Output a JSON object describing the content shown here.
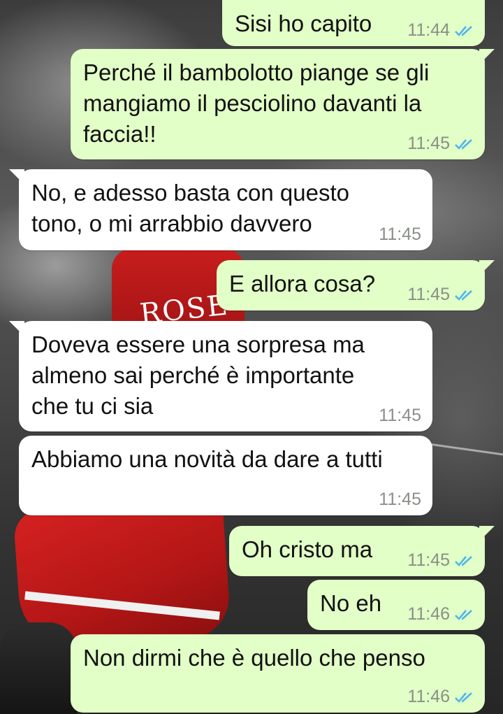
{
  "messages": [
    {
      "direction": "outgoing",
      "text": "Sisi ho capito",
      "time": "11:44",
      "status": "read"
    },
    {
      "direction": "outgoing",
      "text": "Perché il bambolotto piange se gli mangiamo il pesciolino davanti la faccia!!",
      "time": "11:45",
      "status": "read"
    },
    {
      "direction": "incoming",
      "text": "No, e adesso basta con questo tono, o mi arrabbio davvero",
      "time": "11:45"
    },
    {
      "direction": "outgoing",
      "text": "E allora cosa?",
      "time": "11:45",
      "status": "read"
    },
    {
      "direction": "incoming",
      "text": "Doveva essere una sorpresa ma almeno sai perché è importante che tu ci sia",
      "time": "11:45"
    },
    {
      "direction": "incoming",
      "text": "Abbiamo una novità da dare a tutti",
      "time": "11:45"
    },
    {
      "direction": "outgoing",
      "text": "Oh cristo ma",
      "time": "11:45",
      "status": "read"
    },
    {
      "direction": "outgoing",
      "text": "No eh",
      "time": "11:46",
      "status": "read"
    },
    {
      "direction": "outgoing",
      "text": "Non dirmi che è quello che penso",
      "time": "11:46",
      "status": "read"
    }
  ],
  "wallpaper": {
    "jersey_text": "ROSE"
  },
  "colors": {
    "outgoing_bubble": "#e2ffc7",
    "incoming_bubble": "#ffffff",
    "read_ticks": "#4fb6ec",
    "timestamp": "#8a8f88"
  },
  "icons": {
    "read_receipt": "double-check-icon"
  }
}
